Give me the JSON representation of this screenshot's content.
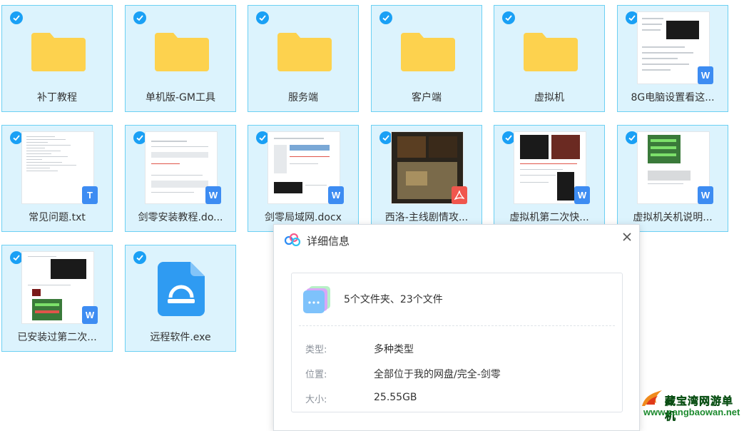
{
  "files": [
    {
      "name": "补丁教程",
      "kind": "folder"
    },
    {
      "name": "单机版-GM工具",
      "kind": "folder"
    },
    {
      "name": "服务端",
      "kind": "folder"
    },
    {
      "name": "客户端",
      "kind": "folder"
    },
    {
      "name": "虚拟机",
      "kind": "folder"
    },
    {
      "name": "8G电脑设置看这...",
      "kind": "word"
    },
    {
      "name": "常见问题.txt",
      "kind": "txt"
    },
    {
      "name": "剑零安装教程.do...",
      "kind": "word"
    },
    {
      "name": "剑零局域网.docx",
      "kind": "word"
    },
    {
      "name": "西洛-主线剧情攻...",
      "kind": "pdf"
    },
    {
      "name": "虚拟机第二次快...",
      "kind": "word"
    },
    {
      "name": "虚拟机关机说明...",
      "kind": "word"
    },
    {
      "name": "已安装过第二次...",
      "kind": "word"
    },
    {
      "name": "远程软件.exe",
      "kind": "exe"
    }
  ],
  "badges": {
    "word": "W",
    "txt": "T"
  },
  "dialog": {
    "title": "详细信息",
    "summary": "5个文件夹、23个文件",
    "type_label": "类型:",
    "type_value": "多种类型",
    "location_label": "位置:",
    "location_value": "全部位于我的网盘/完全-剑零",
    "size_label": "大小:",
    "size_value": "25.55GB"
  },
  "watermark": {
    "line1": "藏宝湾网游单机",
    "line2": "www.cangbaowan.net"
  },
  "colors": {
    "tile_bg": "#dcf3fd",
    "tile_border": "#6cd0f3",
    "check": "#1aa0f5",
    "folder": "#fdd24e",
    "word": "#3d8cf2",
    "pdf": "#f0564d"
  }
}
